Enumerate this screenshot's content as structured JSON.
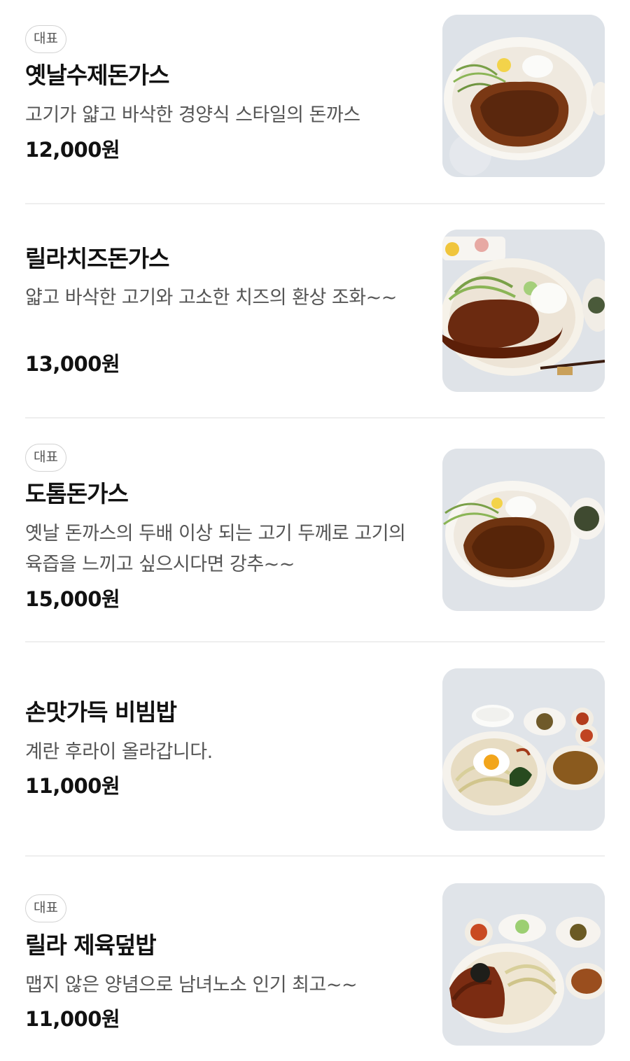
{
  "menu": {
    "items": [
      {
        "badge": "대표",
        "name": "옛날수제돈가스",
        "description": "고기가 얇고 바삭한 경양식 스타일의 돈까스",
        "price": "12,000원",
        "image_icon": "pork-cutlet-plate-photo"
      },
      {
        "badge": "",
        "name": "릴라치즈돈가스",
        "description": "얇고 바삭한 고기와 고소한 치즈의 환상 조화~~",
        "price": "13,000원",
        "image_icon": "cheese-pork-cutlet-plate-photo"
      },
      {
        "badge": "대표",
        "name": "도톰돈가스",
        "description": "옛날 돈까스의 두배 이상 되는 고기 두께로 고기의 육즙을 느끼고 싶으시다면 강추~~",
        "price": "15,000원",
        "image_icon": "thick-pork-cutlet-plate-photo"
      },
      {
        "badge": "",
        "name": "손맛가득 비빔밥",
        "description": "계란 후라이 올라갑니다.",
        "price": "11,000원",
        "image_icon": "bibimbap-bowl-photo"
      },
      {
        "badge": "대표",
        "name": "릴라 제육덮밥",
        "description": "맵지 않은 양념으로 남녀노소 인기 최고~~",
        "price": "11,000원",
        "image_icon": "spicy-pork-rice-bowl-photo"
      }
    ]
  },
  "colors": {
    "text_primary": "#111111",
    "text_secondary": "#555555",
    "badge_border": "#d3d3d3",
    "divider": "#eeeeee",
    "image_background": "#dfe3e8"
  }
}
